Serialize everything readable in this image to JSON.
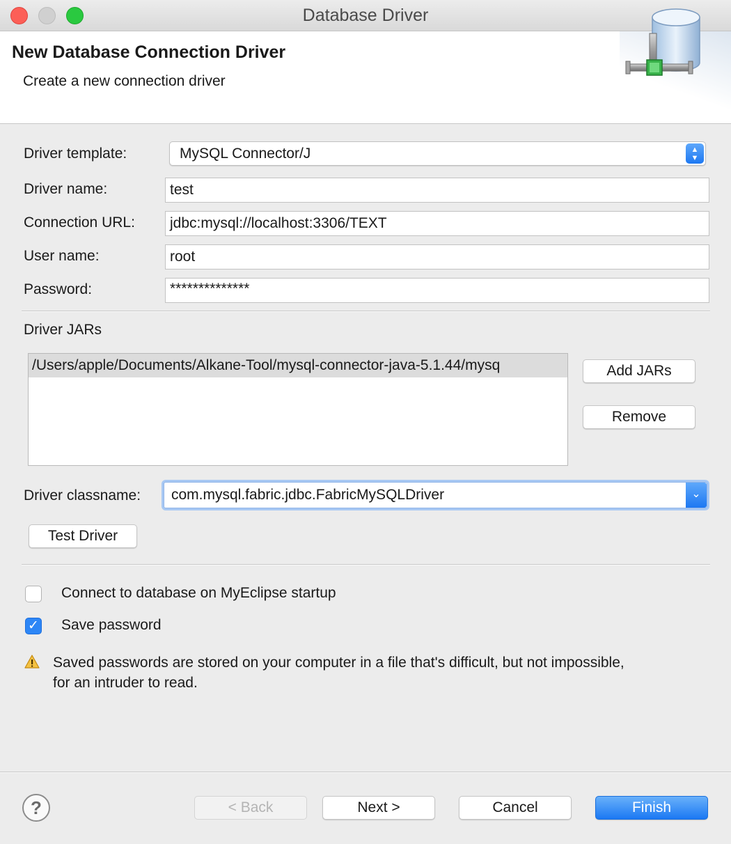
{
  "window": {
    "title": "Database Driver"
  },
  "header": {
    "title": "New Database Connection Driver",
    "subtitle": "Create a new connection driver",
    "icon": "database-connection-icon"
  },
  "form": {
    "driver_template": {
      "label": "Driver template:",
      "value": "MySQL Connector/J"
    },
    "driver_name": {
      "label": "Driver name:",
      "value": "test"
    },
    "connection_url": {
      "label": "Connection URL:",
      "value": "jdbc:mysql://localhost:3306/TEXT"
    },
    "user_name": {
      "label": "User name:",
      "value": "root"
    },
    "password": {
      "label": "Password:",
      "value": "**************"
    }
  },
  "jars": {
    "label": "Driver JARs",
    "items": [
      "/Users/apple/Documents/Alkane-Tool/mysql-connector-java-5.1.44/mysq"
    ],
    "add_label": "Add JARs",
    "remove_label": "Remove"
  },
  "driver_class": {
    "label": "Driver classname:",
    "value": "com.mysql.fabric.jdbc.FabricMySQLDriver"
  },
  "test_driver_label": "Test Driver",
  "options": {
    "connect_on_startup": {
      "label": "Connect to database on MyEclipse startup",
      "checked": false
    },
    "save_password": {
      "label": "Save password",
      "checked": true
    }
  },
  "warning": {
    "icon": "warning-icon",
    "text": "Saved passwords are stored on your computer in a file that's difficult, but not impossible, for an intruder to read."
  },
  "footer": {
    "help_icon": "help-icon",
    "back_label": "< Back",
    "next_label": "Next >",
    "cancel_label": "Cancel",
    "finish_label": "Finish"
  },
  "colors": {
    "accent": "#1b78f3",
    "traffic_close": "#fc5f57",
    "traffic_max": "#2ac940"
  }
}
